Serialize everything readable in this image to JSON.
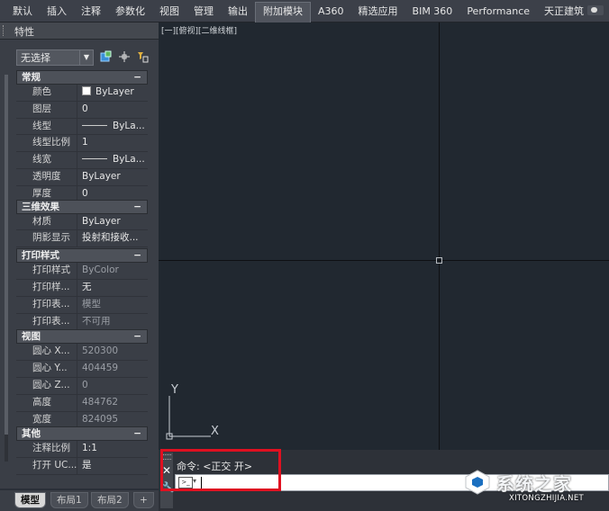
{
  "ribbon": {
    "tabs": [
      {
        "label": "默认"
      },
      {
        "label": "插入"
      },
      {
        "label": "注释"
      },
      {
        "label": "参数化"
      },
      {
        "label": "视图"
      },
      {
        "label": "管理"
      },
      {
        "label": "输出"
      },
      {
        "label": "附加模块",
        "active": true
      },
      {
        "label": "A360"
      },
      {
        "label": "精选应用"
      },
      {
        "label": "BIM 360"
      },
      {
        "label": "Performance"
      },
      {
        "label": "天正建筑"
      }
    ]
  },
  "palette": {
    "title": "特性",
    "selection": "无选择",
    "sections": [
      {
        "title": "常规",
        "rows": [
          {
            "name": "颜色",
            "value": "ByLayer",
            "kind": "color"
          },
          {
            "name": "图层",
            "value": "0"
          },
          {
            "name": "线型",
            "value": "ByLa...",
            "kind": "line"
          },
          {
            "name": "线型比例",
            "value": "1"
          },
          {
            "name": "线宽",
            "value": "ByLa...",
            "kind": "line"
          },
          {
            "name": "透明度",
            "value": "ByLayer"
          },
          {
            "name": "厚度",
            "value": "0"
          }
        ]
      },
      {
        "title": "三维效果",
        "rows": [
          {
            "name": "材质",
            "value": "ByLayer"
          },
          {
            "name": "阴影显示",
            "value": "投射和接收..."
          }
        ]
      },
      {
        "title": "打印样式",
        "rows": [
          {
            "name": "打印样式",
            "value": "ByColor",
            "dim": true
          },
          {
            "name": "打印样...",
            "value": "无"
          },
          {
            "name": "打印表...",
            "value": "模型",
            "dim": true
          },
          {
            "name": "打印表...",
            "value": "不可用",
            "dim": true
          }
        ]
      },
      {
        "title": "视图",
        "rows": [
          {
            "name": "圆心 X...",
            "value": "520300",
            "dim": true
          },
          {
            "name": "圆心 Y...",
            "value": "404459",
            "dim": true
          },
          {
            "name": "圆心 Z...",
            "value": "0",
            "dim": true
          },
          {
            "name": "高度",
            "value": "484762",
            "dim": true
          },
          {
            "name": "宽度",
            "value": "824095",
            "dim": true
          }
        ]
      },
      {
        "title": "其他",
        "rows": [
          {
            "name": "注释比例",
            "value": "1:1"
          },
          {
            "name": "打开 UC...",
            "value": "是"
          }
        ]
      }
    ]
  },
  "layout_tabs": [
    "模型",
    "布局1",
    "布局2",
    "+"
  ],
  "viewport_label": "[一][俯视][二维线框]",
  "ucs": {
    "y": "Y",
    "x": "X"
  },
  "command": {
    "history": "命令:  <正交 开>",
    "prompt_icon": ">_"
  },
  "watermark": {
    "cn": "系统之家",
    "en": "XITONGZHIJIA.NET"
  },
  "colors": {
    "canvas": "#212830",
    "highlight": "#e01020"
  }
}
